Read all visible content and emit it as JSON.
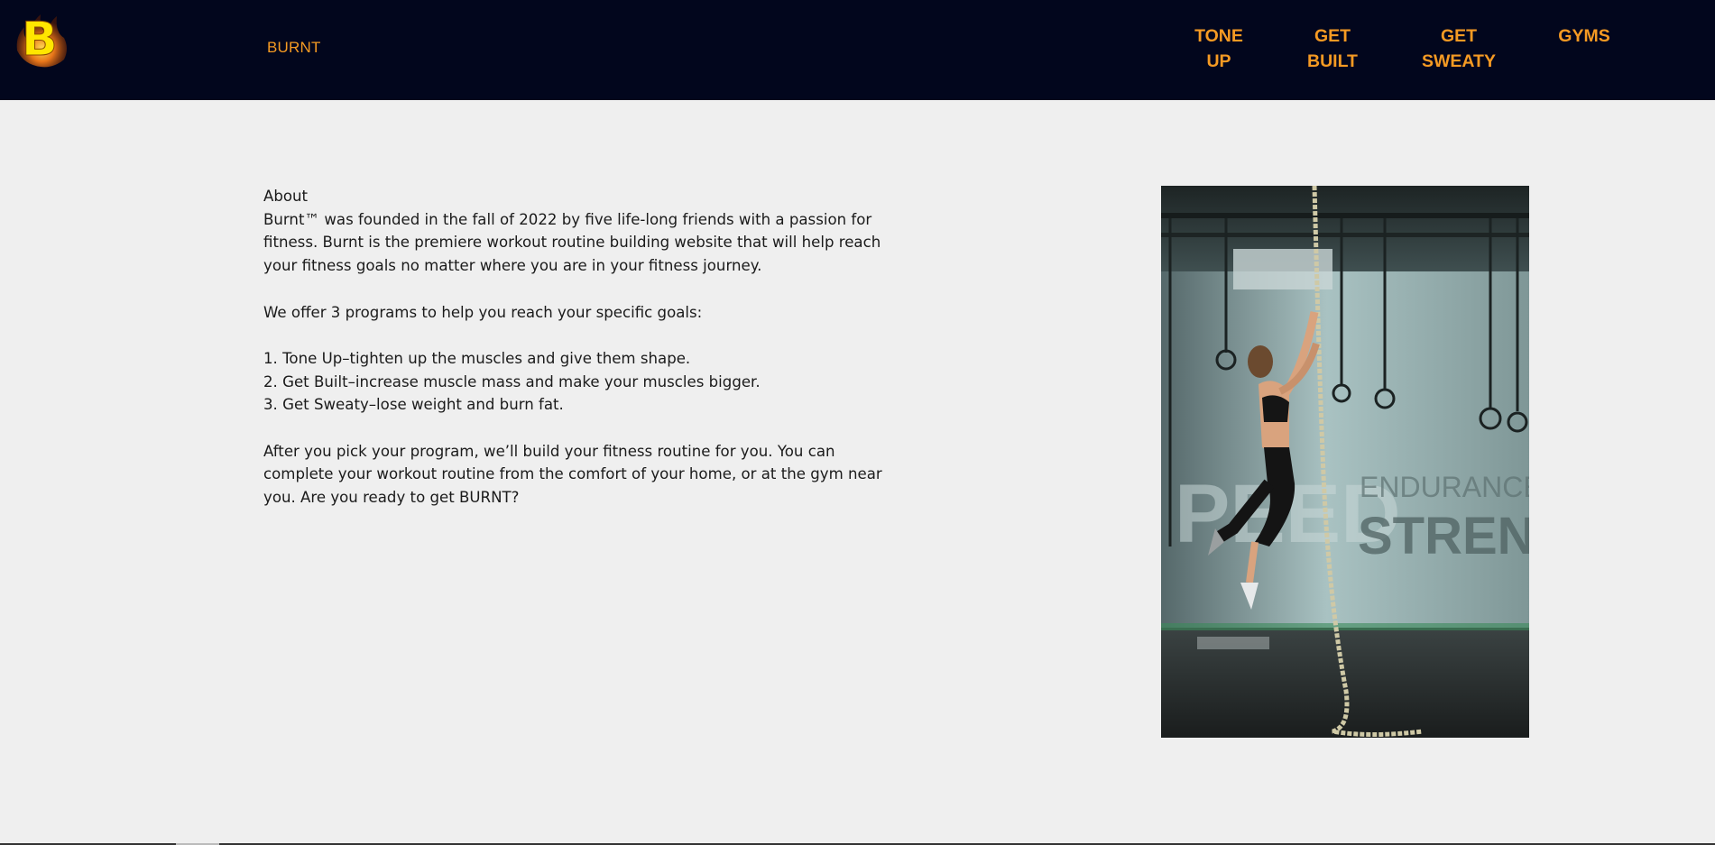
{
  "header": {
    "logo_letter": "B",
    "brand": "BURNT",
    "nav": [
      {
        "line1": "TONE",
        "line2": "UP"
      },
      {
        "line1": "GET",
        "line2": "BUILT"
      },
      {
        "line1": "GET",
        "line2": "SWEATY"
      },
      {
        "line1": "GYMS",
        "line2": ""
      }
    ],
    "colors": {
      "bar": "#02061d",
      "accent": "#f59a23",
      "logo": "#ffe600"
    }
  },
  "about": {
    "heading": "About",
    "intro": "Burnt™ was founded in the fall of 2022 by five life-long friends with a passion for fitness. Burnt is the premiere workout routine building website that will help reach your fitness goals no matter where you are in your fitness journey.",
    "programs_intro": "We offer 3 programs to help you reach your specific goals:",
    "programs": [
      "1. Tone Up–tighten up the muscles and give them shape.",
      "2. Get Built–increase muscle mass and make your muscles bigger.",
      "3. Get Sweaty–lose weight and burn fat."
    ],
    "closing": "After you pick your program, we’ll build your fitness routine for you. You can complete your workout routine from the comfort of your home, or at the gym near you. Are you ready to get BURNT?"
  },
  "photo": {
    "wall_text_1": "PEED",
    "wall_text_2": "ENDURANCE",
    "wall_text_3": "STRENGTH"
  }
}
